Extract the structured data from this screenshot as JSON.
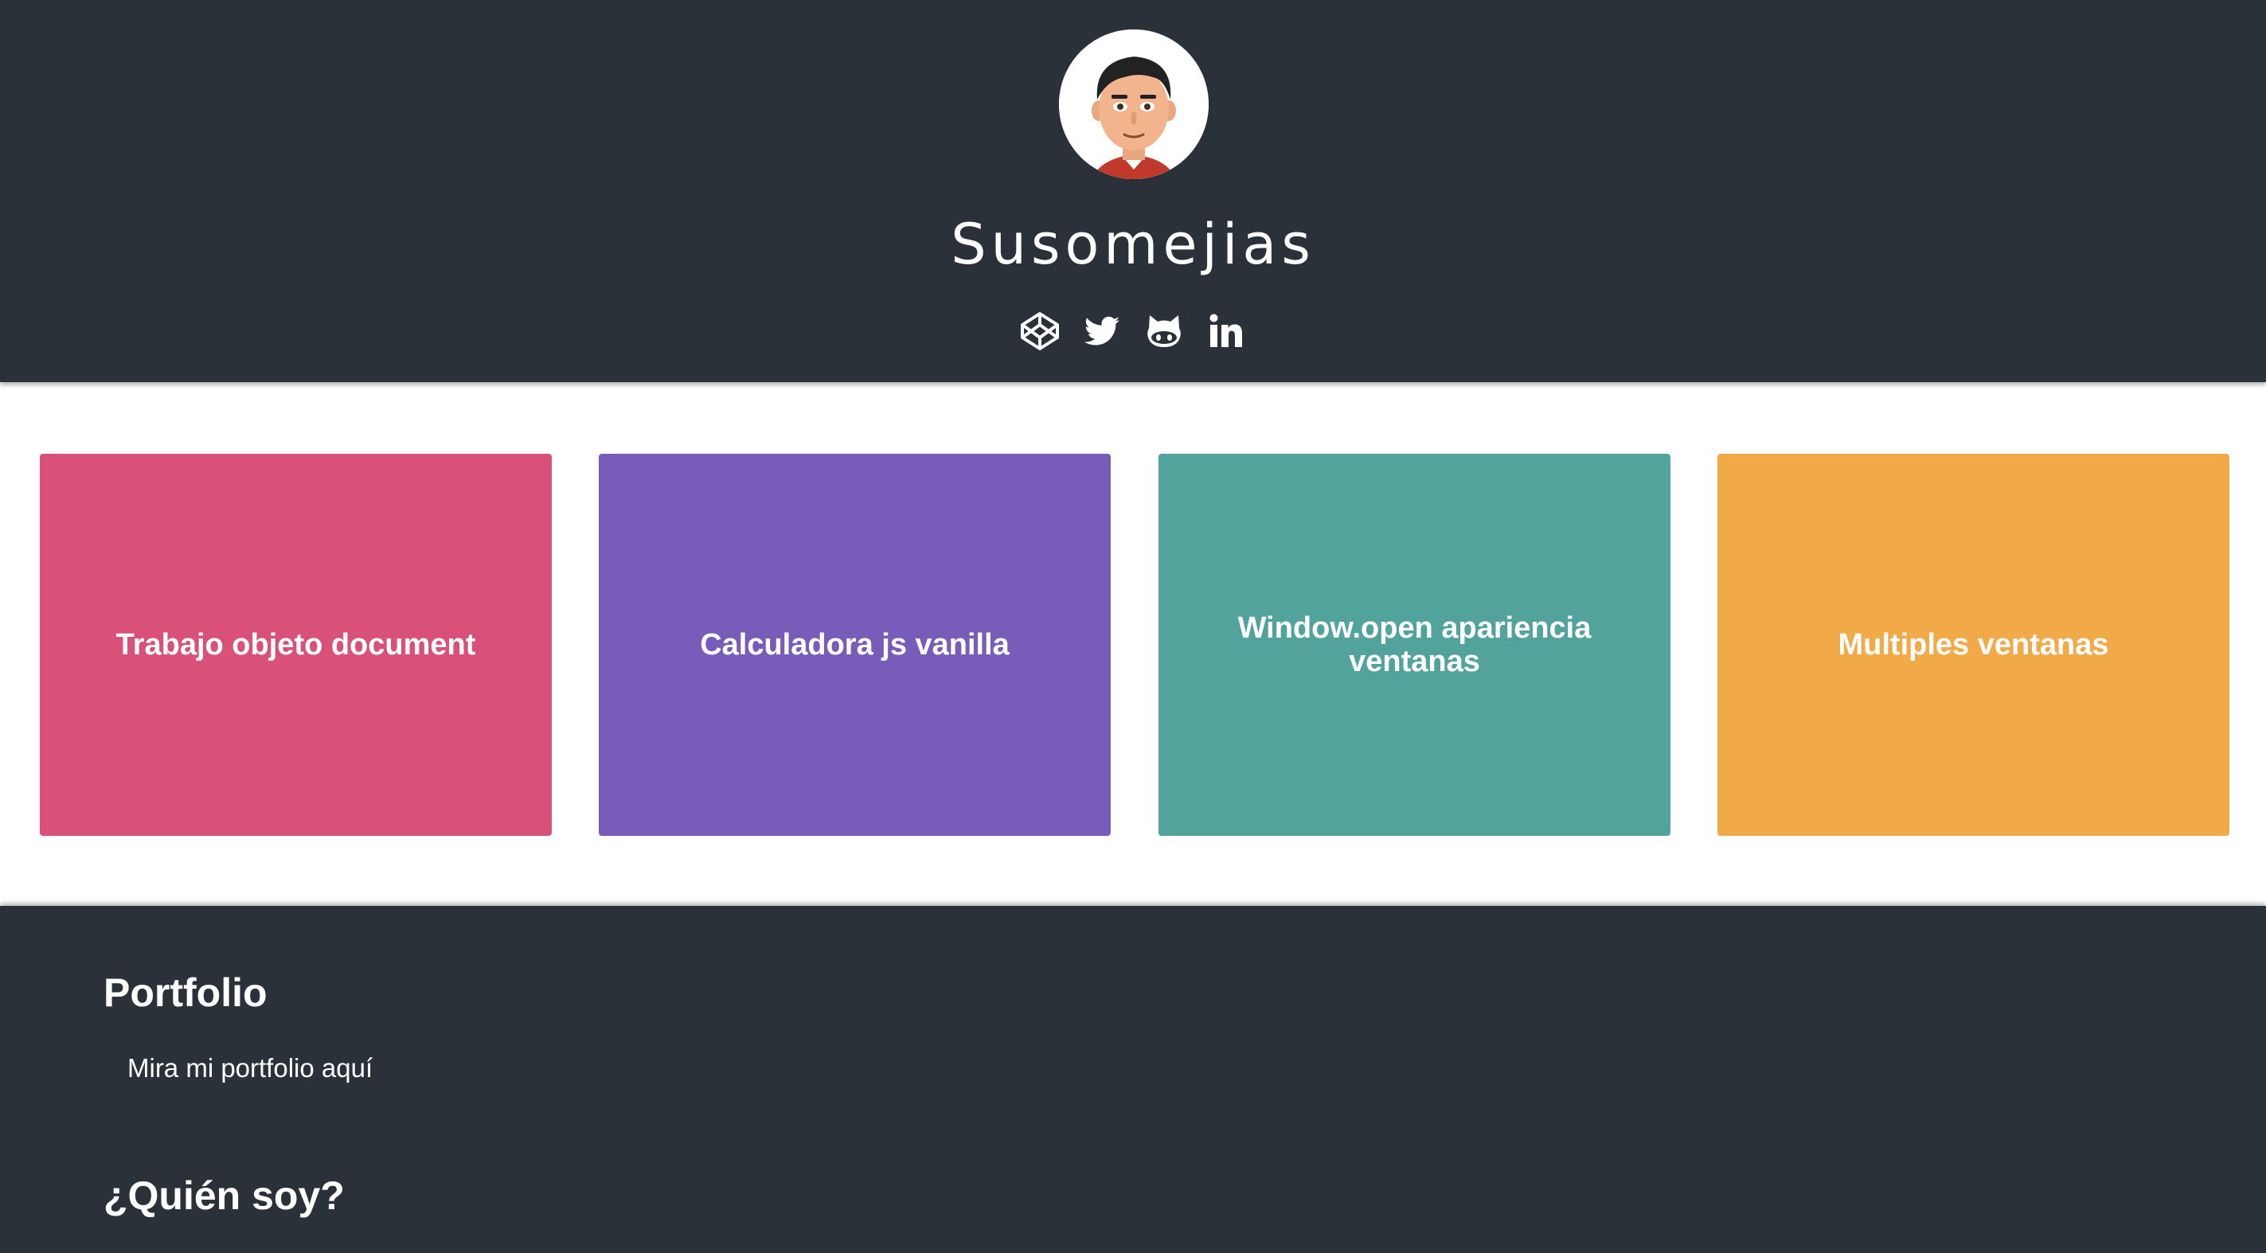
{
  "header": {
    "title": "Susomejias",
    "avatar_icon": "avatar-illustration",
    "social": [
      {
        "name": "codepen",
        "icon": "codepen-icon"
      },
      {
        "name": "twitter",
        "icon": "twitter-icon"
      },
      {
        "name": "github",
        "icon": "github-icon"
      },
      {
        "name": "linkedin",
        "icon": "linkedin-icon"
      }
    ]
  },
  "cards": [
    {
      "label": "Trabajo objeto document",
      "color": "#d95079"
    },
    {
      "label": "Calculadora js vanilla",
      "color": "#785cba"
    },
    {
      "label": "Window.open apariencia ventanas",
      "color": "#51a39b"
    },
    {
      "label": "Multiples ventanas",
      "color": "#f2a947"
    }
  ],
  "footer": {
    "portfolio_heading": "Portfolio",
    "portfolio_link": "Mira mi portfolio aquí",
    "about_heading": "¿Quién soy?"
  },
  "colors": {
    "dark_bg": "#2a3139",
    "text": "#ffffff"
  }
}
